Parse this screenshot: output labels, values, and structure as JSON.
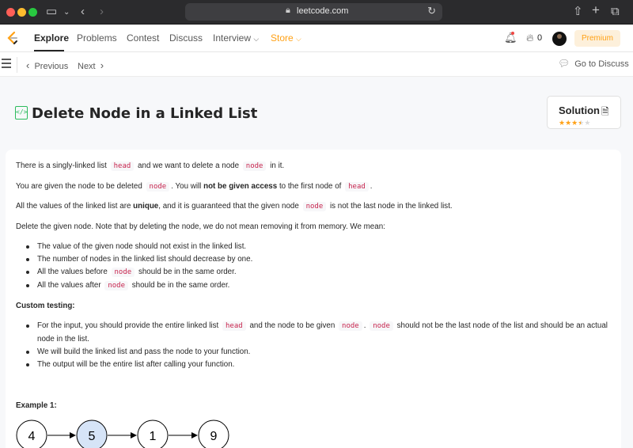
{
  "browser": {
    "url": "leetcode.com"
  },
  "nav": {
    "items": [
      "Explore",
      "Problems",
      "Contest",
      "Discuss",
      "Interview",
      "Store"
    ],
    "fire_count": "0",
    "premium": "Premium"
  },
  "subbar": {
    "previous": "Previous",
    "next": "Next",
    "discuss": "Go to Discuss"
  },
  "problem": {
    "title": "Delete Node in a Linked List",
    "solution_label": "Solution",
    "rating_stars": 3.5
  },
  "content": {
    "p1_a": "There is a singly-linked list",
    "p1_code1": "head",
    "p1_b": "and we want to delete a node",
    "p1_code2": "node",
    "p1_c": "in it.",
    "p2_a": "You are given the node to be deleted",
    "p2_code1": "node",
    "p2_b": ". You will",
    "p2_bold": "not be given access",
    "p2_c": "to the first node of",
    "p2_code2": "head",
    "p2_d": ".",
    "p3_a": "All the values of the linked list are",
    "p3_bold": "unique",
    "p3_b": ", and it is guaranteed that the given node",
    "p3_code": "node",
    "p3_c": "is not the last node in the linked list.",
    "p4": "Delete the given node. Note that by deleting the node, we do not mean removing it from memory. We mean:",
    "b1": "The value of the given node should not exist in the linked list.",
    "b2": "The number of nodes in the linked list should decrease by one.",
    "b3_a": "All the values before",
    "b3_code": "node",
    "b3_b": "should be in the same order.",
    "b4_a": "All the values after",
    "b4_code": "node",
    "b4_b": "should be in the same order.",
    "custom_heading": "Custom testing:",
    "c1_a": "For the input, you should provide the entire linked list",
    "c1_code1": "head",
    "c1_b": "and the node to be given",
    "c1_code2": "node",
    "c1_c": ".",
    "c1_code3": "node",
    "c1_d": "should not be the last node of the list and should be an actual",
    "c1_e": "node in the list.",
    "c2": "We will build the linked list and pass the node to your function.",
    "c3": "The output will be the entire list after calling your function.",
    "example_heading": "Example 1:",
    "example_nodes": [
      "4",
      "5",
      "1",
      "9"
    ]
  },
  "colors": {
    "accent": "#ffa116",
    "code_text": "#c7254e",
    "highlight_node": "#d6e4f7"
  }
}
